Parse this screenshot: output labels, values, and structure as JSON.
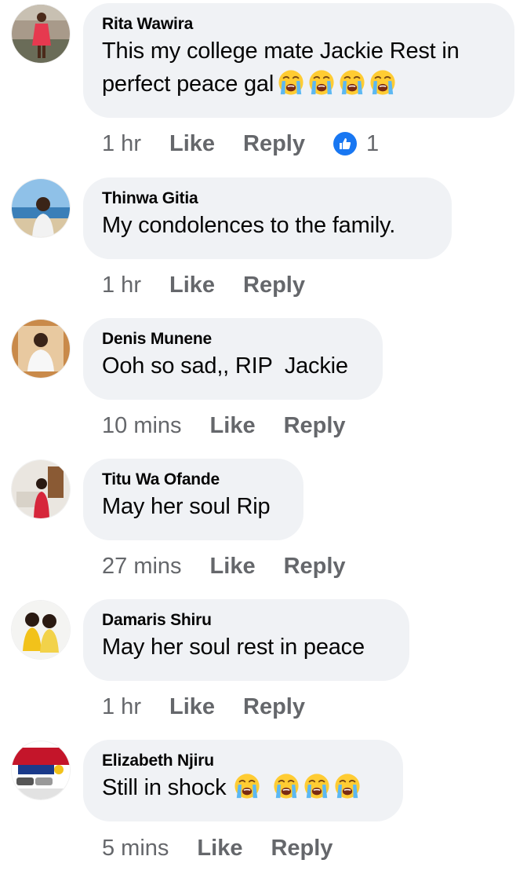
{
  "comments": [
    {
      "author": "Rita Wawira",
      "text_line1": "This my college mate Jackie Rest in",
      "text_line2": "perfect peace gal",
      "emojis": [
        "loudly-crying-face",
        "loudly-crying-face",
        "loudly-crying-face",
        "loudly-crying-face"
      ],
      "time": "1 hr",
      "like_label": "Like",
      "reply_label": "Reply",
      "reaction_count": "1",
      "avatar_icon": "avatar-woman-red-dress"
    },
    {
      "author": "Thinwa Gitia",
      "text": "My condolences to the family.",
      "time": "1 hr",
      "like_label": "Like",
      "reply_label": "Reply",
      "avatar_icon": "avatar-man-beach"
    },
    {
      "author": "Denis Munene",
      "text": "Ooh so sad,, RIP  Jackie",
      "time": "10 mins",
      "like_label": "Like",
      "reply_label": "Reply",
      "avatar_icon": "avatar-man-white-shirt"
    },
    {
      "author": "Titu Wa Ofande",
      "text": "May her soul Rip",
      "time": "27 mins",
      "like_label": "Like",
      "reply_label": "Reply",
      "avatar_icon": "avatar-woman-office"
    },
    {
      "author": "Damaris Shiru",
      "text": "May her soul rest in peace",
      "time": "1 hr",
      "like_label": "Like",
      "reply_label": "Reply",
      "avatar_icon": "avatar-two-children"
    },
    {
      "author": "Elizabeth Njiru",
      "text": "Still in shock",
      "emojis": [
        "loudly-crying-face",
        "loudly-crying-face",
        "loudly-crying-face",
        "loudly-crying-face"
      ],
      "time": "5 mins",
      "like_label": "Like",
      "reply_label": "Reply",
      "avatar_icon": "avatar-car-advert"
    }
  ],
  "colors": {
    "bubble": "#f0f2f5",
    "meta_text": "#65676b",
    "like_badge": "#1877f2"
  }
}
